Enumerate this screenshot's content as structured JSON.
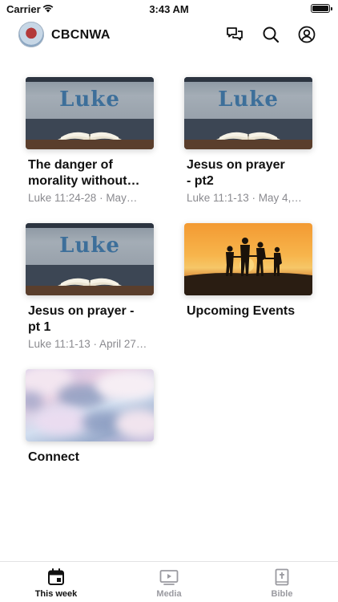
{
  "status_bar": {
    "carrier": "Carrier",
    "time": "3:43 AM"
  },
  "header": {
    "title": "CBCNWA",
    "icons": [
      "chat-icon",
      "search-icon",
      "profile-icon"
    ]
  },
  "cards": [
    {
      "title": "The danger of\nmorality without…",
      "subtitle": "Luke 11:24-28 · May…",
      "thumbnail": "luke",
      "thumb_word": "Luke"
    },
    {
      "title": "Jesus on prayer\n- pt2",
      "subtitle": "Luke 11:1-13 · May 4,…",
      "thumbnail": "luke",
      "thumb_word": "Luke"
    },
    {
      "title": "Jesus on prayer -\npt 1",
      "subtitle": "Luke 11:1-13 · April 27…",
      "thumbnail": "luke",
      "thumb_word": "Luke"
    },
    {
      "title": "Upcoming Events",
      "subtitle": "",
      "thumbnail": "sunset"
    },
    {
      "title": "Connect",
      "subtitle": "",
      "thumbnail": "clouds"
    }
  ],
  "tabs": [
    {
      "label": "This week",
      "icon": "calendar-icon",
      "active": true
    },
    {
      "label": "Media",
      "icon": "play-icon",
      "active": false
    },
    {
      "label": "Bible",
      "icon": "bible-icon",
      "active": false
    }
  ],
  "colors": {
    "text": "#111111",
    "secondary_text": "#8a8a8f",
    "inactive_tab": "#9a9aa0"
  }
}
